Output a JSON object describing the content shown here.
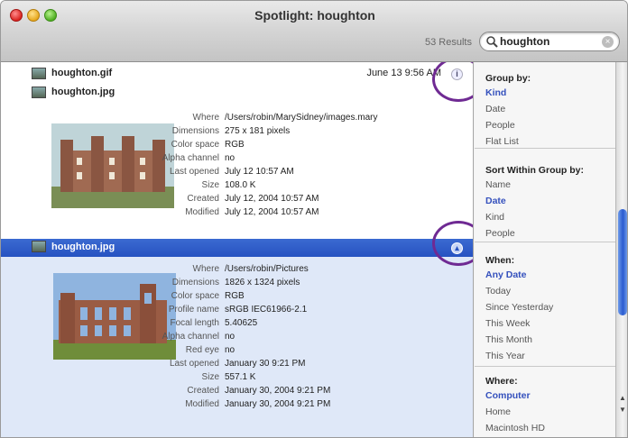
{
  "window": {
    "title": "Spotlight: houghton",
    "results_count": "53 Results"
  },
  "search": {
    "value": "houghton",
    "icon": "magnifier-icon",
    "clear_icon": "clear-icon"
  },
  "results": [
    {
      "name": "houghton.gif",
      "date": "June 13 9:56 AM",
      "selected": false
    },
    {
      "name": "houghton.jpg",
      "date": "",
      "selected": false,
      "meta": [
        {
          "k": "Where",
          "v": "/Users/robin/MarySidney/images.mary"
        },
        {
          "k": "Dimensions",
          "v": "275 x 181 pixels"
        },
        {
          "k": "Color space",
          "v": "RGB"
        },
        {
          "k": "Alpha channel",
          "v": "no"
        },
        {
          "k": "Last opened",
          "v": "July 12 10:57 AM"
        },
        {
          "k": "Size",
          "v": "108.0 K"
        },
        {
          "k": "Created",
          "v": "July 12, 2004 10:57 AM"
        },
        {
          "k": "Modified",
          "v": "July 12, 2004 10:57 AM"
        }
      ]
    },
    {
      "name": "houghton.jpg",
      "date": "",
      "selected": true,
      "meta": [
        {
          "k": "Where",
          "v": "/Users/robin/Pictures"
        },
        {
          "k": "Dimensions",
          "v": "1826 x 1324 pixels"
        },
        {
          "k": "Color space",
          "v": "RGB"
        },
        {
          "k": "Profile name",
          "v": "sRGB IEC61966-2.1"
        },
        {
          "k": "Focal length",
          "v": "5.40625"
        },
        {
          "k": "Alpha channel",
          "v": "no"
        },
        {
          "k": "Red eye",
          "v": "no"
        },
        {
          "k": "Last opened",
          "v": "January 30 9:21 PM"
        },
        {
          "k": "Size",
          "v": "557.1 K"
        },
        {
          "k": "Created",
          "v": "January 30, 2004 9:21 PM"
        },
        {
          "k": "Modified",
          "v": "January 30, 2004 9:21 PM"
        }
      ]
    }
  ],
  "sidebar": {
    "group_by": {
      "heading": "Group by:",
      "items": [
        "Kind",
        "Date",
        "People",
        "Flat List"
      ],
      "active": "Kind"
    },
    "sort_by": {
      "heading": "Sort Within Group by:",
      "items": [
        "Name",
        "Date",
        "Kind",
        "People"
      ],
      "active": "Date"
    },
    "when": {
      "heading": "When:",
      "items": [
        "Any Date",
        "Today",
        "Since Yesterday",
        "This Week",
        "This Month",
        "This Year"
      ],
      "active": "Any Date"
    },
    "where": {
      "heading": "Where:",
      "items": [
        "Computer",
        "Home",
        "Macintosh HD"
      ],
      "active": "Computer"
    }
  },
  "colors": {
    "selection": "#2652c1",
    "annotation": "#6f2a93",
    "link": "#3551bd"
  }
}
